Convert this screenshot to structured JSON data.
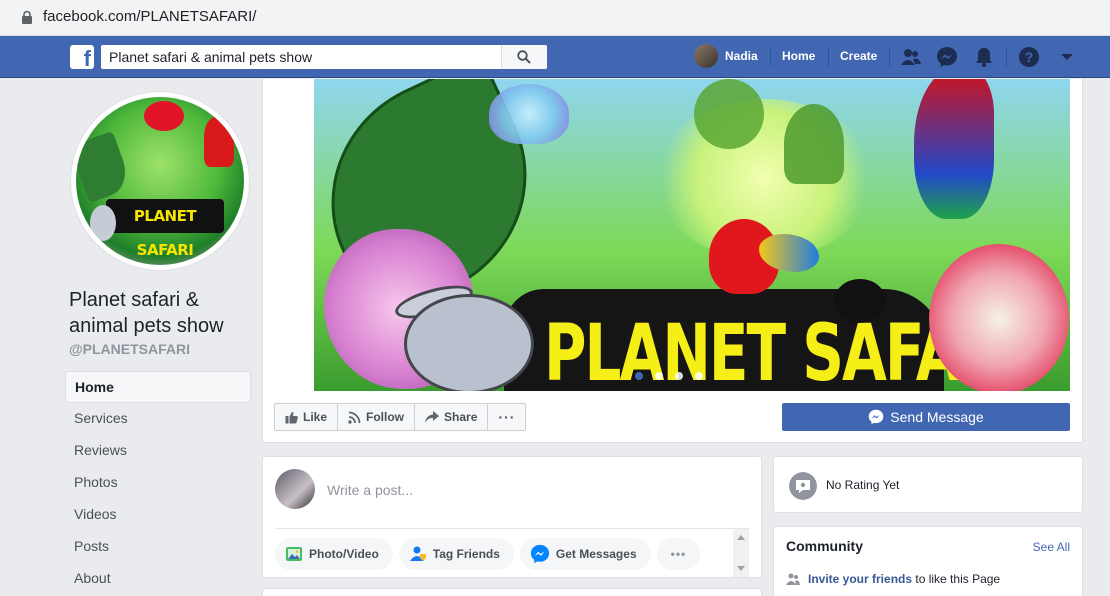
{
  "browser": {
    "url": "facebook.com/PLANETSAFARI/"
  },
  "topnav": {
    "search_value": "Planet safari & animal pets show",
    "user_name": "Nadia",
    "home_label": "Home",
    "create_label": "Create",
    "icons": [
      "friends-icon",
      "messenger-icon",
      "notifications-icon",
      "help-icon",
      "menu-caret-icon"
    ]
  },
  "page": {
    "name": "Planet safari & animal pets show",
    "handle": "@PLANETSAFARI",
    "profile_logo_text": "PLANET SAFARI",
    "cover_text": "PLANET SAFARI"
  },
  "leftnav": {
    "items": [
      {
        "label": "Home",
        "active": true
      },
      {
        "label": "Services"
      },
      {
        "label": "Reviews"
      },
      {
        "label": "Photos"
      },
      {
        "label": "Videos"
      },
      {
        "label": "Posts"
      },
      {
        "label": "About"
      }
    ]
  },
  "actions": {
    "like": "Like",
    "follow": "Follow",
    "share": "Share",
    "more": "···",
    "send_message": "Send Message"
  },
  "composer": {
    "placeholder": "Write a post...",
    "photo_video": "Photo/Video",
    "tag_friends": "Tag Friends",
    "get_messages": "Get Messages",
    "more": "•••"
  },
  "rating": {
    "text": "No Rating Yet"
  },
  "community": {
    "title": "Community",
    "see_all": "See All",
    "invite_link": "Invite your friends",
    "invite_rest": "to like this Page"
  },
  "colors": {
    "fb_blue": "#4267b2",
    "page_bg": "#e9ebee",
    "link": "#385898"
  }
}
